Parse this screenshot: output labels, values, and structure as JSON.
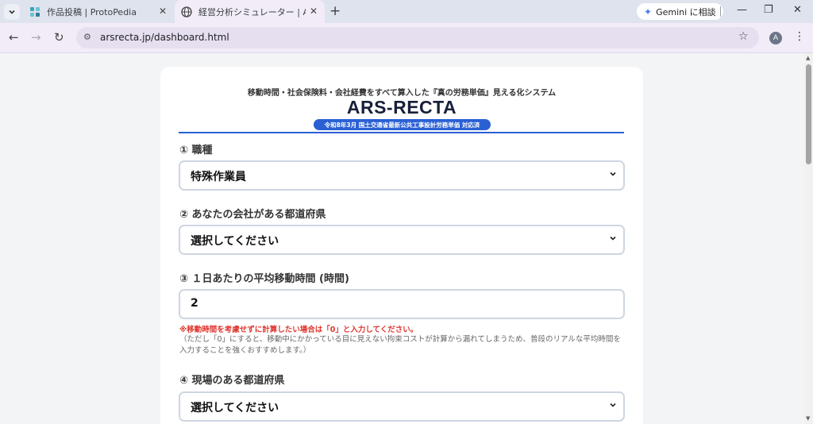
{
  "browser": {
    "tabs": [
      {
        "title": "作品投稿 | ProtoPedia",
        "favicon": "protopedia-icon"
      },
      {
        "title": "経営分析シミュレーター | ARS-RECTA",
        "favicon": "globe-icon",
        "active": true
      }
    ],
    "gemini_label": "Gemini に相談",
    "url": "arsrecta.jp/dashboard.html",
    "avatar_letter": "A"
  },
  "page": {
    "subtitle": "移動時間・社会保険料・会社経費をすべて算入した『真の労務単価』見える化システム",
    "brand": "ARS-RECTA",
    "badge": "令和8年3月 国土交通省最新公共工事設計労務単価 対応済",
    "fields": [
      {
        "label": "① 職種",
        "value": "特殊作業員",
        "type": "select"
      },
      {
        "label": "② あなたの会社がある都道府県",
        "value": "選択してください",
        "type": "select"
      },
      {
        "label": "③ １日あたりの平均移動時間 (時間)",
        "value": "2",
        "type": "input"
      },
      {
        "label": "④ 現場のある都道府県",
        "value": "選択してください",
        "type": "select"
      }
    ],
    "warning": "※移動時間を考慮せずに計算したい場合は「0」と入力してください。",
    "note": "（ただし「0」にすると、移動中にかかっている目に見えない拘束コストが計算から漏れてしまうため、普段のリアルな平均時間を入力することを強くおすすめします。）"
  },
  "colors": {
    "accent": "#2a60d4",
    "warning": "#e0342c"
  }
}
